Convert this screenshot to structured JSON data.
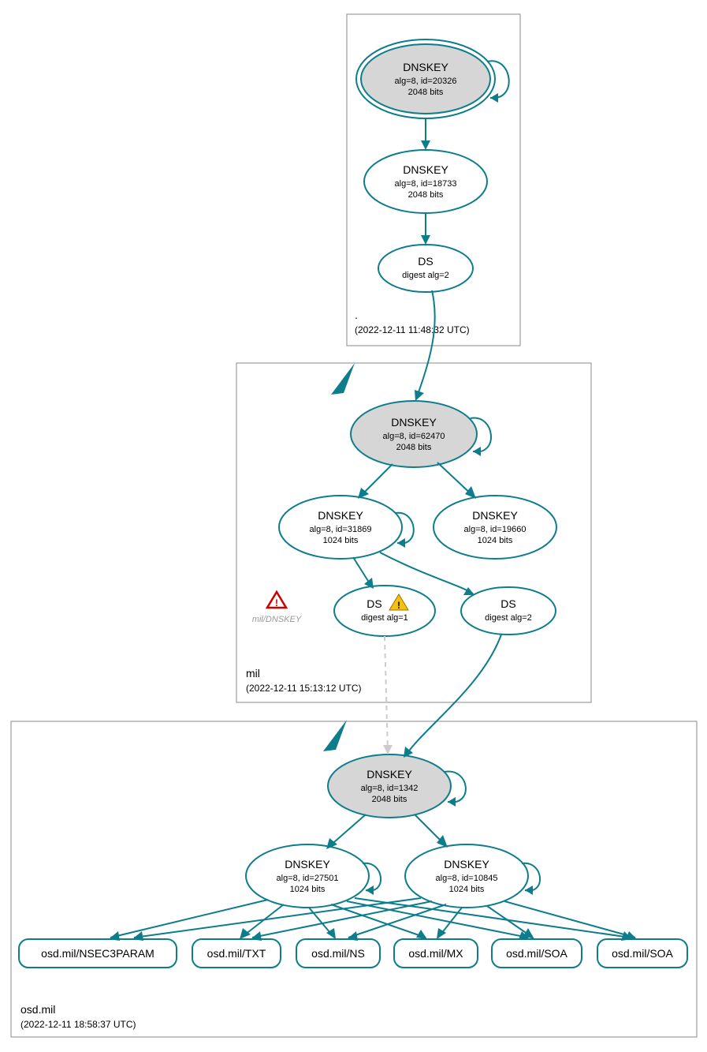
{
  "zones": {
    "root": {
      "name": ".",
      "timestamp": "(2022-12-11 11:48:32 UTC)"
    },
    "mil": {
      "name": "mil",
      "timestamp": "(2022-12-11 15:13:12 UTC)"
    },
    "osd": {
      "name": "osd.mil",
      "timestamp": "(2022-12-11 18:58:37 UTC)"
    }
  },
  "nodes": {
    "root_ksk": {
      "title": "DNSKEY",
      "line2": "alg=8, id=20326",
      "line3": "2048 bits"
    },
    "root_zsk": {
      "title": "DNSKEY",
      "line2": "alg=8, id=18733",
      "line3": "2048 bits"
    },
    "root_ds": {
      "title": "DS",
      "line2": "digest alg=2"
    },
    "mil_ksk": {
      "title": "DNSKEY",
      "line2": "alg=8, id=62470",
      "line3": "2048 bits"
    },
    "mil_zsk1": {
      "title": "DNSKEY",
      "line2": "alg=8, id=31869",
      "line3": "1024 bits"
    },
    "mil_zsk2": {
      "title": "DNSKEY",
      "line2": "alg=8, id=19660",
      "line3": "1024 bits"
    },
    "mil_ds1": {
      "title": "DS",
      "line2": "digest alg=1"
    },
    "mil_ds2": {
      "title": "DS",
      "line2": "digest alg=2"
    },
    "mil_warn": {
      "label": "mil/DNSKEY"
    },
    "osd_ksk": {
      "title": "DNSKEY",
      "line2": "alg=8, id=1342",
      "line3": "2048 bits"
    },
    "osd_zsk1": {
      "title": "DNSKEY",
      "line2": "alg=8, id=27501",
      "line3": "1024 bits"
    },
    "osd_zsk2": {
      "title": "DNSKEY",
      "line2": "alg=8, id=10845",
      "line3": "1024 bits"
    }
  },
  "rrsets": {
    "r1": "osd.mil/NSEC3PARAM",
    "r2": "osd.mil/TXT",
    "r3": "osd.mil/NS",
    "r4": "osd.mil/MX",
    "r5": "osd.mil/SOA",
    "r6": "osd.mil/SOA"
  }
}
